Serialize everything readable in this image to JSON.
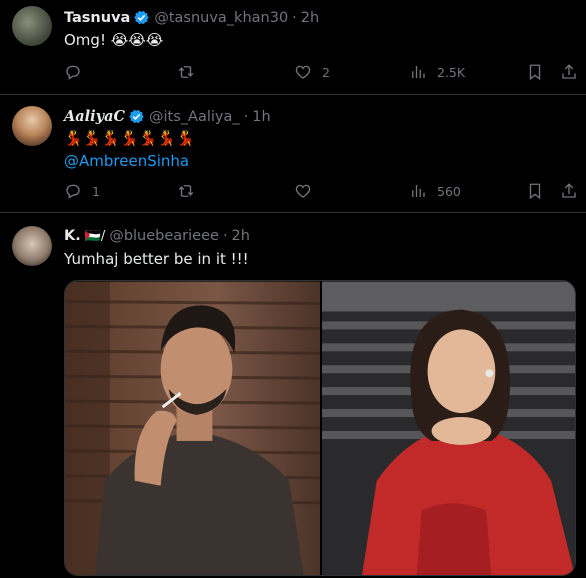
{
  "tweets": [
    {
      "name": "Tasnuva",
      "handle": "@tasnuva_khan30",
      "time": "2h",
      "text": "Omg!",
      "emoji": "😭😭😭",
      "replies": "",
      "retweets": "",
      "likes": "2",
      "views": "2.5K"
    },
    {
      "name": "AaliyaC",
      "handle": "@its_Aaliya_",
      "time": "1h",
      "text_emoji": "💃💃💃💃💃💃💃",
      "mention": "@AmbreenSinha",
      "replies": "1",
      "retweets": "",
      "likes": "",
      "views": "560"
    },
    {
      "name": "K.",
      "flags": "🇵🇸/",
      "handle": "@bluebearieee",
      "time": "2h",
      "text": "Yumhaj better be in it !!!"
    }
  ],
  "colors": {
    "background": "#000000",
    "text": "#e7e9ea",
    "muted": "#71767b",
    "accent": "#1d9bf0",
    "divider": "#2f3336",
    "verified": "#1d9bf0"
  },
  "icons": [
    "reply-icon",
    "retweet-icon",
    "like-icon",
    "views-icon",
    "bookmark-icon",
    "share-icon",
    "verified-badge-icon"
  ]
}
